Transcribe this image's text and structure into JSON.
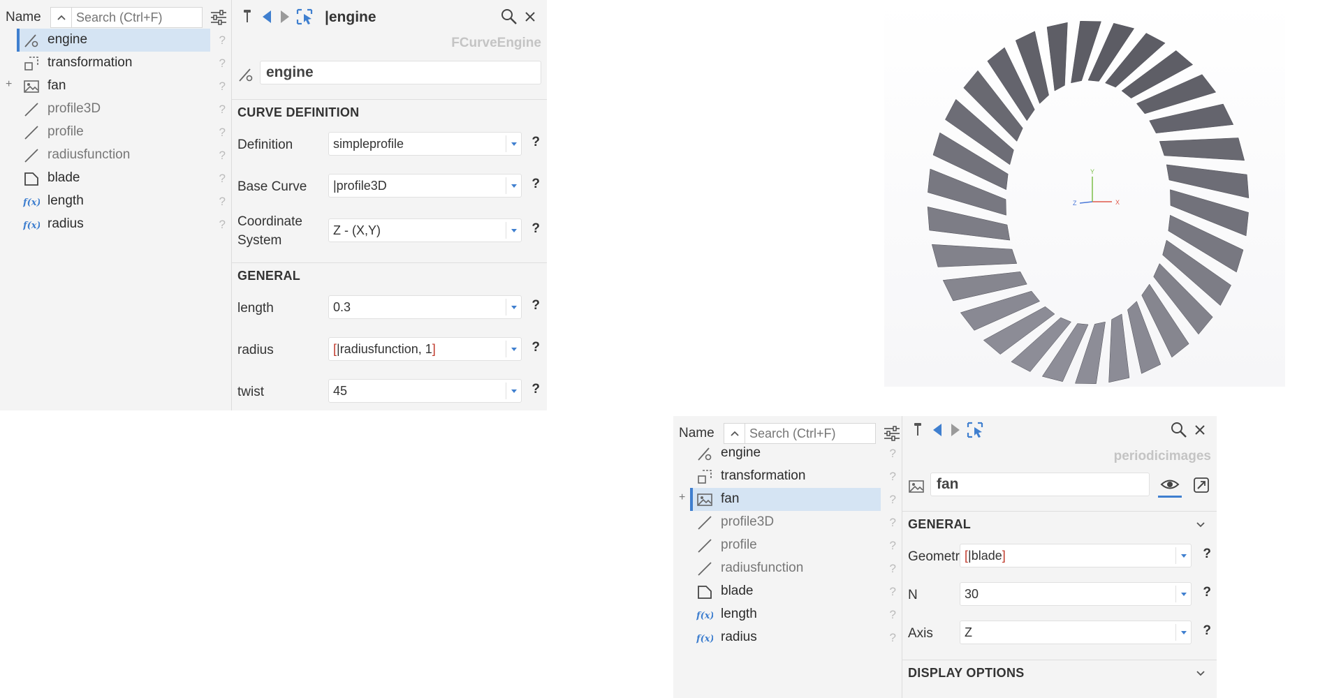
{
  "top_panel": {
    "tree": {
      "header_label": "Name",
      "search_placeholder": "Search (Ctrl+F)",
      "items": [
        {
          "label": "engine",
          "icon": "curve-engine-icon",
          "selected": true,
          "dim": false,
          "expander": ""
        },
        {
          "label": "transformation",
          "icon": "transformation-icon",
          "selected": false,
          "dim": false,
          "expander": ""
        },
        {
          "label": "fan",
          "icon": "periodic-images-icon",
          "selected": false,
          "dim": false,
          "expander": "+"
        },
        {
          "label": "profile3D",
          "icon": "curve-icon",
          "selected": false,
          "dim": true,
          "expander": ""
        },
        {
          "label": "profile",
          "icon": "curve-icon",
          "selected": false,
          "dim": true,
          "expander": ""
        },
        {
          "label": "radiusfunction",
          "icon": "curve-icon",
          "selected": false,
          "dim": true,
          "expander": ""
        },
        {
          "label": "blade",
          "icon": "surface-icon",
          "selected": false,
          "dim": false,
          "expander": ""
        },
        {
          "label": "length",
          "icon": "function-icon",
          "selected": false,
          "dim": false,
          "expander": ""
        },
        {
          "label": "radius",
          "icon": "function-icon",
          "selected": false,
          "dim": false,
          "expander": ""
        }
      ],
      "help": "?"
    },
    "props": {
      "title": "|engine",
      "type": "FCurveEngine",
      "name": "engine",
      "sections": [
        {
          "title": "CURVE DEFINITION",
          "properties": [
            {
              "label": "Definition",
              "value": "simpleprofile"
            },
            {
              "label": "Base Curve",
              "value": "|profile3D"
            },
            {
              "label": "Coordinate System",
              "value": "Z - (X,Y)"
            }
          ]
        },
        {
          "title": "GENERAL",
          "properties": [
            {
              "label": "length",
              "value": "0.3"
            },
            {
              "label": "radius",
              "value_open": "[",
              "value_ref": "|radiusfunction, 1",
              "value_close": "]"
            },
            {
              "label": "twist",
              "value": "45"
            }
          ]
        }
      ],
      "help": "?"
    }
  },
  "viewport": {
    "blade_count": 30,
    "axes": {
      "x": "X",
      "y": "Y",
      "z": "Z"
    },
    "colors": {
      "blade_light": "#8e8e98",
      "blade_dark": "#5c5c64",
      "x_axis": "#e0584a",
      "y_axis": "#7cbf4a",
      "z_axis": "#4a78d8"
    }
  },
  "bottom_panel": {
    "tree": {
      "header_label": "Name",
      "search_placeholder": "Search (Ctrl+F)",
      "items": [
        {
          "label": "engine",
          "icon": "curve-engine-icon",
          "selected": false,
          "dim": false,
          "expander": ""
        },
        {
          "label": "transformation",
          "icon": "transformation-icon",
          "selected": false,
          "dim": false,
          "expander": ""
        },
        {
          "label": "fan",
          "icon": "periodic-images-icon",
          "selected": true,
          "dim": false,
          "expander": "+"
        },
        {
          "label": "profile3D",
          "icon": "curve-icon",
          "selected": false,
          "dim": true,
          "expander": ""
        },
        {
          "label": "profile",
          "icon": "curve-icon",
          "selected": false,
          "dim": true,
          "expander": ""
        },
        {
          "label": "radiusfunction",
          "icon": "curve-icon",
          "selected": false,
          "dim": true,
          "expander": ""
        },
        {
          "label": "blade",
          "icon": "surface-icon",
          "selected": false,
          "dim": false,
          "expander": ""
        },
        {
          "label": "length",
          "icon": "function-icon",
          "selected": false,
          "dim": false,
          "expander": ""
        },
        {
          "label": "radius",
          "icon": "function-icon",
          "selected": false,
          "dim": false,
          "expander": ""
        }
      ],
      "help": "?"
    },
    "props": {
      "type": "periodicimages",
      "name": "fan",
      "sections": [
        {
          "title": "GENERAL",
          "properties": [
            {
              "label": "Geometry",
              "value_open": "[",
              "value_ref": "|blade",
              "value_close": "]"
            },
            {
              "label": "N",
              "value": "30"
            },
            {
              "label": "Axis",
              "value": "Z"
            }
          ]
        },
        {
          "title": "DISPLAY OPTIONS",
          "properties": []
        }
      ],
      "help": "?"
    }
  },
  "colors": {
    "accent": "#3f7fcf",
    "selection": "#d5e4f3",
    "panel_bg": "#f4f4f4"
  }
}
